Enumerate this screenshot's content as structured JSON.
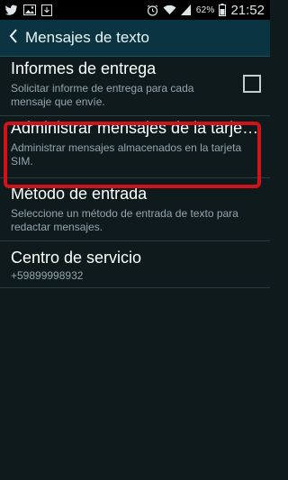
{
  "status_bar": {
    "icons_left": [
      "twitter-icon",
      "image-icon",
      "download-icon"
    ],
    "icons_right": [
      "alarm-icon",
      "wifi-icon",
      "signal-icon",
      "battery-icon"
    ],
    "battery": "62%",
    "time": "21:52"
  },
  "header": {
    "back_icon": "chevron-left-icon",
    "title": "Mensajes de texto"
  },
  "settings": [
    {
      "title": "Informes de entrega",
      "summary": "Solicitar informe de entrega para cada mensaje que envíe.",
      "checkbox_checked": false
    },
    {
      "title": "Administrar mensajes de la tarje…",
      "summary": "Administrar mensajes almacenados en la tarjeta SIM."
    },
    {
      "title": "Método de entrada",
      "summary": "Seleccione un método de entrada de texto para redactar mensajes."
    },
    {
      "title": "Centro de servicio",
      "summary": "+59899998932"
    }
  ],
  "colors": {
    "highlight_border": "#d0131b",
    "appbar": "#0b3442",
    "background": "#0f1a1d"
  }
}
